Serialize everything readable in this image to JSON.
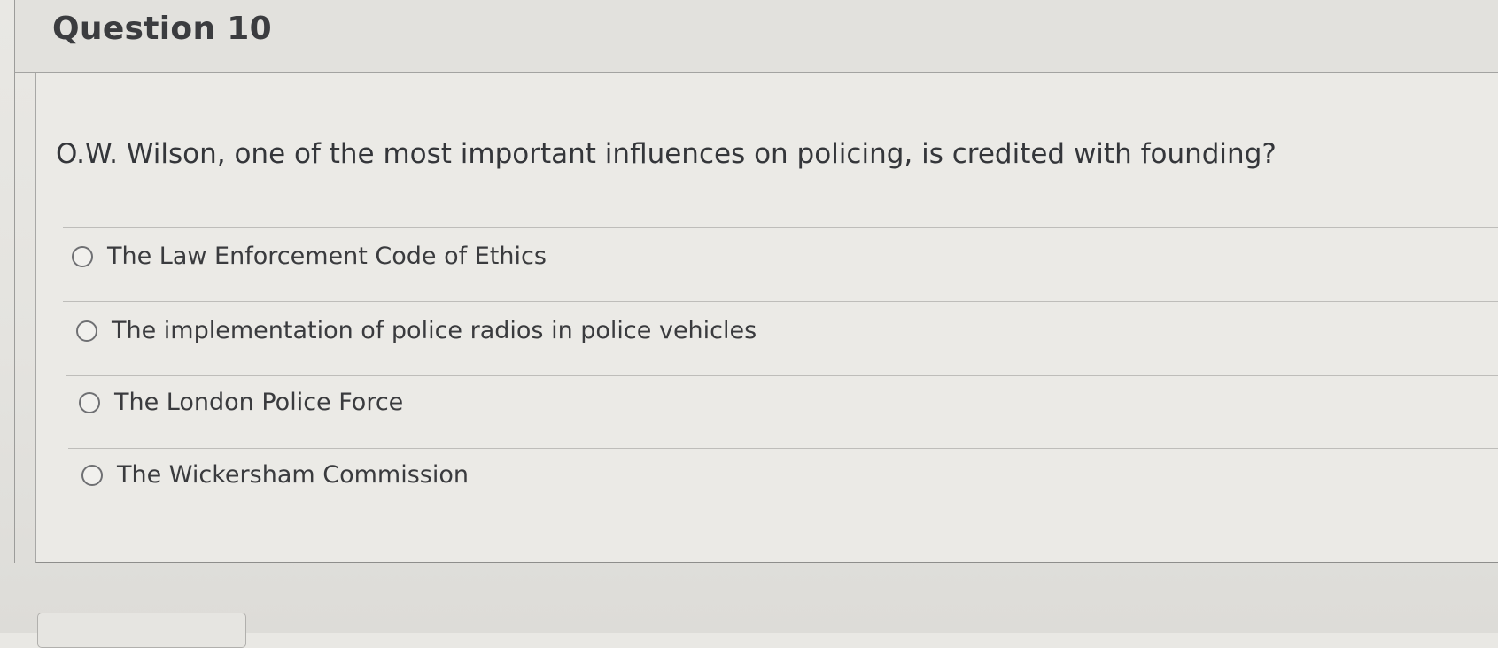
{
  "question": {
    "title": "Question 10",
    "text": "O.W. Wilson, one of the most important influences on policing, is credited with founding?",
    "options": [
      {
        "label": "The Law Enforcement Code of Ethics",
        "selected": false
      },
      {
        "label": "The implementation of police radios in police vehicles",
        "selected": false
      },
      {
        "label": "The London Police Force",
        "selected": false
      },
      {
        "label": "The Wickersham Commission",
        "selected": false
      }
    ]
  }
}
